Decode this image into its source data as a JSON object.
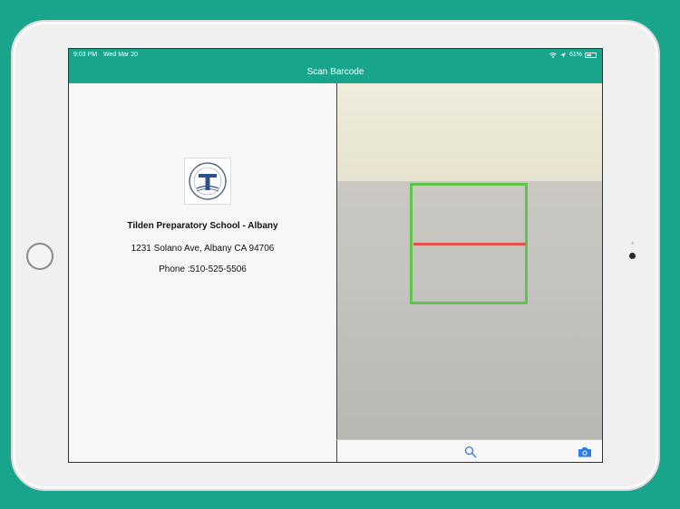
{
  "status_bar": {
    "time": "9:03 PM",
    "date": "Wed Mar 20",
    "battery_percent": "61%",
    "battery_level": 0.61
  },
  "nav": {
    "title": "Scan Barcode"
  },
  "school": {
    "name": "Tilden Preparatory School - Albany",
    "address": "1231 Solano Ave, Albany CA 94706",
    "phone": "Phone :510-525-5506",
    "logo_letter": "T"
  },
  "toolbar": {
    "search_icon": "search-icon",
    "camera_icon": "camera-icon"
  },
  "colors": {
    "accent": "#18a58b",
    "scan_frame": "#5ec44a",
    "scan_line": "#e5524a",
    "toolbar_icon": "#2b7de9"
  }
}
